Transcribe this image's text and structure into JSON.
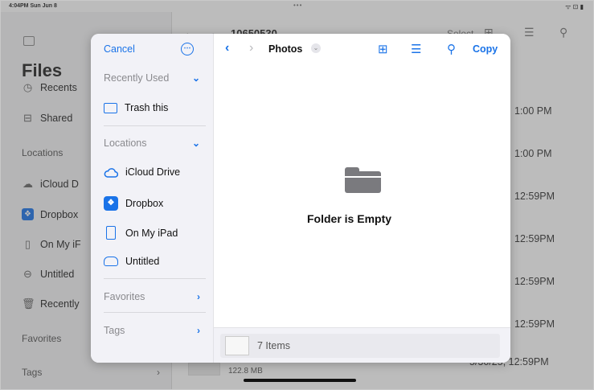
{
  "status_bar": {
    "time": "4:04PM  Sun Jun 8",
    "dots": "•••",
    "right": "ᯤ ⊡ ▮"
  },
  "background": {
    "title": "Files",
    "ellipsis": "⋯",
    "sidebar_items": [
      {
        "label": "Recents",
        "icon": "clock-icon",
        "glyph": "◷"
      },
      {
        "label": "Shared",
        "icon": "shared-folder-icon",
        "glyph": "⊟"
      }
    ],
    "locations_header": "Locations",
    "location_items": [
      {
        "label": "iCloud D",
        "icon": "cloud-icon",
        "glyph": "☁"
      },
      {
        "label": "Dropbox",
        "icon": "dropbox-icon",
        "glyph": "❖"
      },
      {
        "label": "On My iF",
        "icon": "ipad-icon",
        "glyph": "▯"
      },
      {
        "label": "Untitled",
        "icon": "drive-icon",
        "glyph": "⊖"
      },
      {
        "label": "Recently",
        "icon": "trash-icon",
        "glyph": "🗑"
      }
    ],
    "favorites_header": "Favorites",
    "tags_header": "Tags",
    "tags_chevron": "›",
    "folder_title": "10650530",
    "select_label": "Select",
    "row_times": [
      "1:00 PM",
      "1:00 PM",
      "12:59PM",
      "12:59PM",
      "12:59PM",
      "12:59PM"
    ],
    "last_row_time": "5/30/25, 12:59PM",
    "last_row_size": "122.8 MB"
  },
  "modal": {
    "cancel_label": "Cancel",
    "more_icon": "⋯",
    "recently_used_header": "Recently Used",
    "recently_used_items": [
      {
        "label": "Trash this",
        "icon": "folder-icon"
      }
    ],
    "locations_header": "Locations",
    "locations": [
      {
        "label": "iCloud Drive",
        "icon": "icloud-icon"
      },
      {
        "label": "Dropbox",
        "icon": "dropbox-icon"
      },
      {
        "label": "On My iPad",
        "icon": "ipad-icon"
      },
      {
        "label": "Untitled",
        "icon": "external-drive-icon"
      }
    ],
    "favorites_header": "Favorites",
    "tags_header": "Tags",
    "chevron_down": "⌄",
    "chevron_right": "›",
    "back": "‹",
    "forward": "›",
    "folder_title": "Photos",
    "title_chevron": "⌄",
    "new_folder_icon": "⊞",
    "list_icon": "☰",
    "search_icon": "⚲",
    "copy_label": "Copy",
    "empty_message": "Folder is Empty",
    "item_count": "7 Items"
  },
  "colors": {
    "accent": "#1a73e8",
    "dim_overlay": "rgba(80,80,80,0.38)",
    "folder_gray": "#7a7a7e"
  }
}
